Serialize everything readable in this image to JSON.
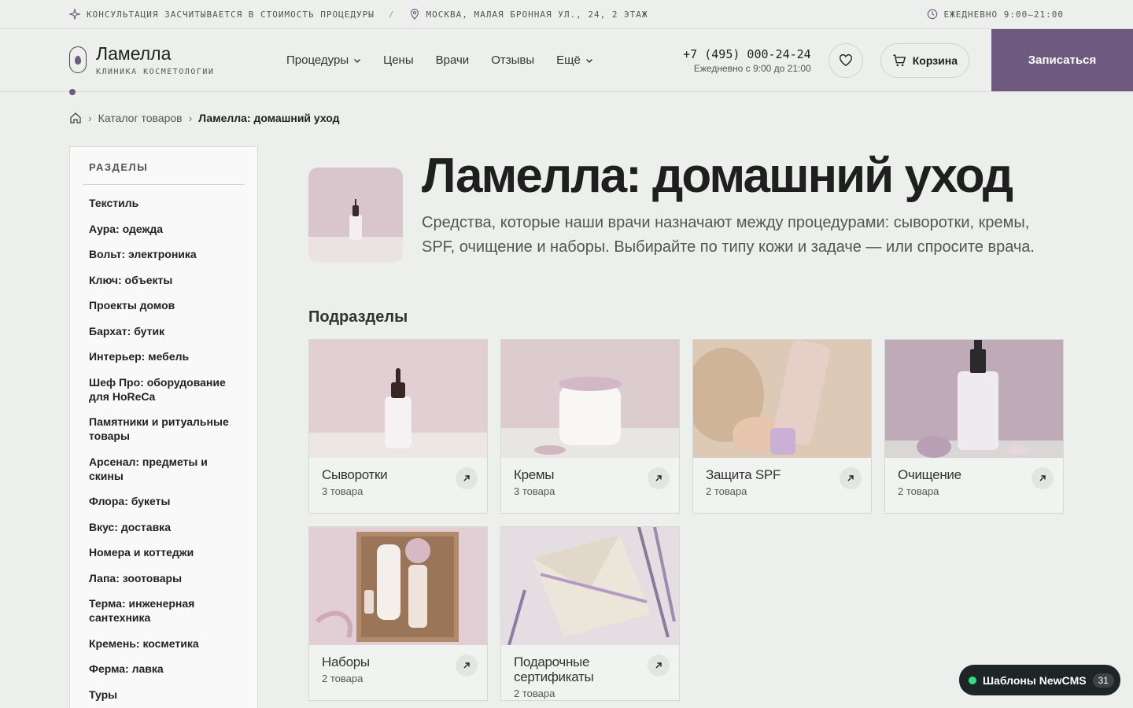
{
  "topbar": {
    "consult": "КОНСУЛЬТАЦИЯ ЗАСЧИТЫВАЕТСЯ В СТОИМОСТЬ ПРОЦЕДУРЫ",
    "separator": "/",
    "address": "МОСКВА, МАЛАЯ БРОННАЯ УЛ., 24, 2 ЭТАЖ",
    "hours": "ЕЖЕДНЕВНО 9:00–21:00"
  },
  "header": {
    "logo_name": "Ламелла",
    "logo_sub": "КЛИНИКА КОСМЕТОЛОГИИ",
    "nav": [
      "Процедуры",
      "Цены",
      "Врачи",
      "Отзывы",
      "Ещё"
    ],
    "phone": "+7 (495) 000-24-24",
    "phone_hours": "Ежедневно с 9:00 до 21:00",
    "cart_label": "Корзина",
    "book_label": "Записаться"
  },
  "breadcrumb": {
    "catalog": "Каталог товаров",
    "current": "Ламелла: домашний уход"
  },
  "sidebar": {
    "title": "РАЗДЕЛЫ",
    "items": [
      "Текстиль",
      "Аура: одежда",
      "Вольт: электроника",
      "Ключ: объекты",
      "Проекты домов",
      "Бархат: бутик",
      "Интерьер: мебель",
      "Шеф Про: оборудование для HoReCa",
      "Памятники и ритуальные товары",
      "Арсенал: предметы и скины",
      "Флора: букеты",
      "Вкус: доставка",
      "Номера и коттеджи",
      "Лапа: зоотовары",
      "Терма: инженерная сантехника",
      "Кремень: косметика",
      "Ферма: лавка",
      "Туры"
    ]
  },
  "main": {
    "title": "Ламелла: домашний уход",
    "description": "Средства, которые наши врачи назначают между процедурами: сыворотки, кремы, SPF, очищение и наборы. Выбирайте по типу кожи и задаче — или спросите врача.",
    "subsections_title": "Подразделы",
    "cards": [
      {
        "name": "Сыворотки",
        "count": "3 товара"
      },
      {
        "name": "Кремы",
        "count": "3 товара"
      },
      {
        "name": "Защита SPF",
        "count": "2 товара"
      },
      {
        "name": "Очищение",
        "count": "2 товара"
      },
      {
        "name": "Наборы",
        "count": "2 товара"
      },
      {
        "name": "Подарочные сертификаты",
        "count": "2 товара"
      }
    ]
  },
  "badge": {
    "label": "Шаблоны NewCMS",
    "count": "31"
  },
  "colors": {
    "accent": "#6e5a7e",
    "background": "#ecefec"
  }
}
